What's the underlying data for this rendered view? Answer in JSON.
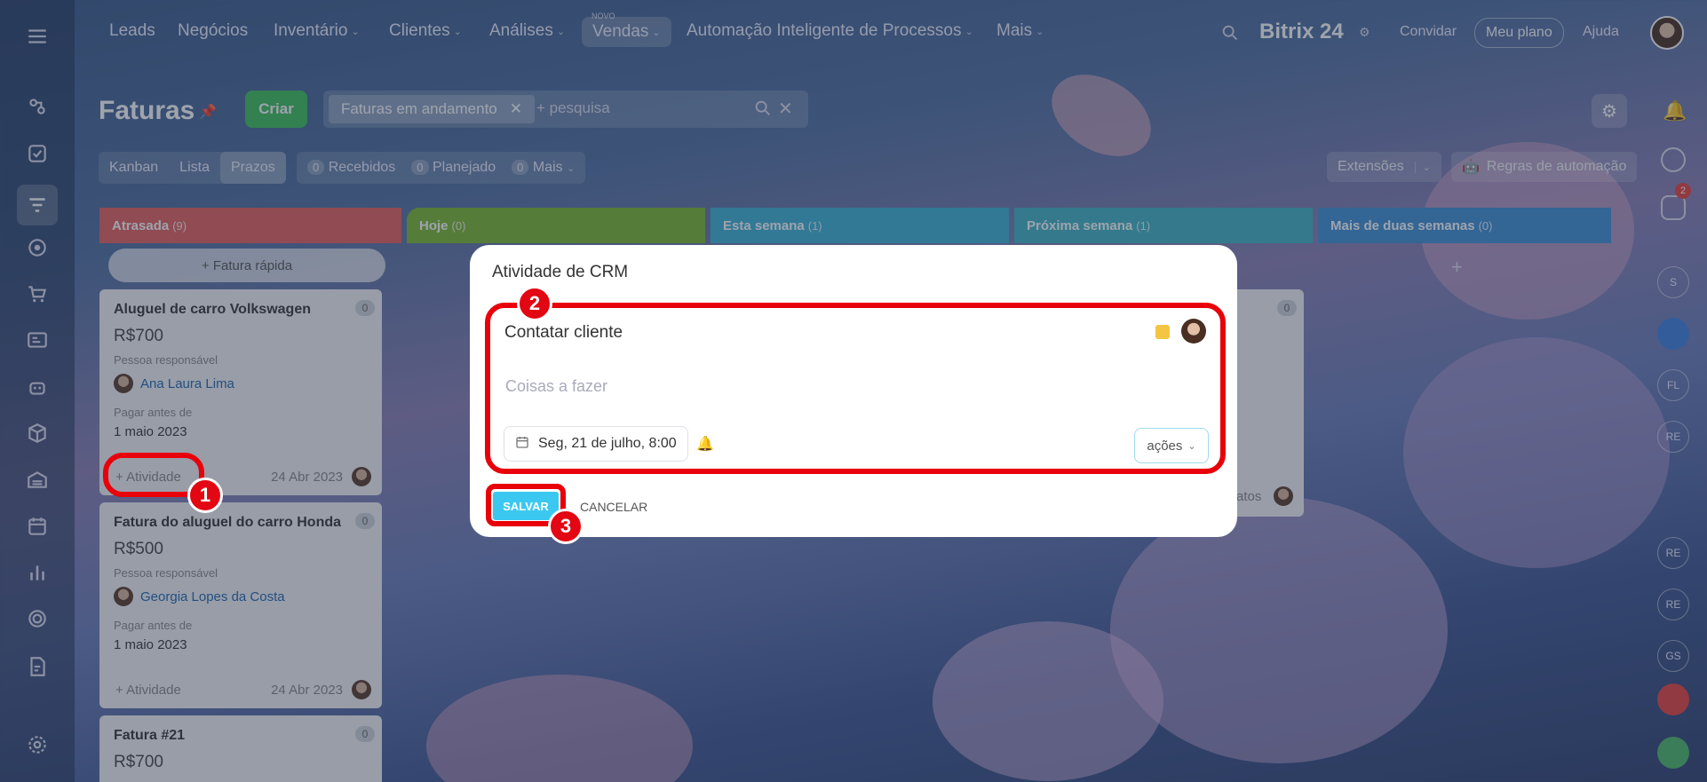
{
  "topnav": {
    "items": [
      "Leads",
      "Negócios",
      "Inventário",
      "Clientes",
      "Análises",
      "Vendas",
      "Automação Inteligente de Processos",
      "Mais"
    ],
    "new_tag": "NOVO",
    "brand": "Bitrix",
    "brand_num": "24",
    "invite": "Convidar",
    "plan": "Meu plano",
    "help": "Ajuda"
  },
  "page": {
    "title": "Faturas",
    "create_button": "Criar",
    "filter_chip": "Faturas em andamento",
    "search_placeholder": "+ pesquisa"
  },
  "views": {
    "kanban": "Kanban",
    "list": "Lista",
    "deadlines": "Prazos"
  },
  "counters": [
    {
      "count": "0",
      "label": "Recebidos"
    },
    {
      "count": "0",
      "label": "Planejado"
    },
    {
      "count": "0",
      "label": "Mais"
    }
  ],
  "right_tools": {
    "extensions": "Extensões",
    "automation": "Regras de automação"
  },
  "columns": [
    {
      "name": "Atrasada",
      "count": "(9)",
      "color": "#e8605e"
    },
    {
      "name": "Hoje",
      "count": "(0)",
      "color": "#7cb82f"
    },
    {
      "name": "Esta semana",
      "count": "(1)",
      "color": "#3bb3d8"
    },
    {
      "name": "Próxima semana",
      "count": "(1)",
      "color": "#3fb5c5"
    },
    {
      "name": "Mais de duas semanas",
      "count": "(0)",
      "color": "#3d8fd6"
    }
  ],
  "quick_invoice": "+ Fatura rápida",
  "cards": [
    {
      "title": "Aluguel de carro Volkswagen",
      "amount": "R$700",
      "resp_label": "Pessoa responsável",
      "person": "Ana Laura Lima",
      "due_label": "Pagar antes de",
      "due": "1 maio 2023",
      "activity": "+ Atividade",
      "date": "24 Abr 2023",
      "badge": "0"
    },
    {
      "title": "Fatura do aluguel do carro Honda",
      "amount": "R$500",
      "resp_label": "Pessoa responsável",
      "person": "Georgia Lopes da Costa",
      "due_label": "Pagar antes de",
      "due": "1 maio 2023",
      "activity": "+ Atividade",
      "date": "24 Abr 2023",
      "badge": "0"
    },
    {
      "title": "Fatura #21",
      "amount": "R$700",
      "badge": "0"
    }
  ],
  "other_card": {
    "badge": "0",
    "partial_text": "atos"
  },
  "modal": {
    "title": "Atividade de CRM",
    "subject": "Contatar cliente",
    "placeholder": "Coisas a fazer",
    "date": "Seg, 21 de julho, 8:00",
    "actions": "ações",
    "save": "SALVAR",
    "cancel": "CANCELAR",
    "color_marker": "#f4c542"
  },
  "callouts": [
    "1",
    "2",
    "3"
  ],
  "right_bar": {
    "notification_count": "2",
    "avatars": [
      "S",
      "FL",
      "RE",
      "RE",
      "RE",
      "GS"
    ]
  }
}
